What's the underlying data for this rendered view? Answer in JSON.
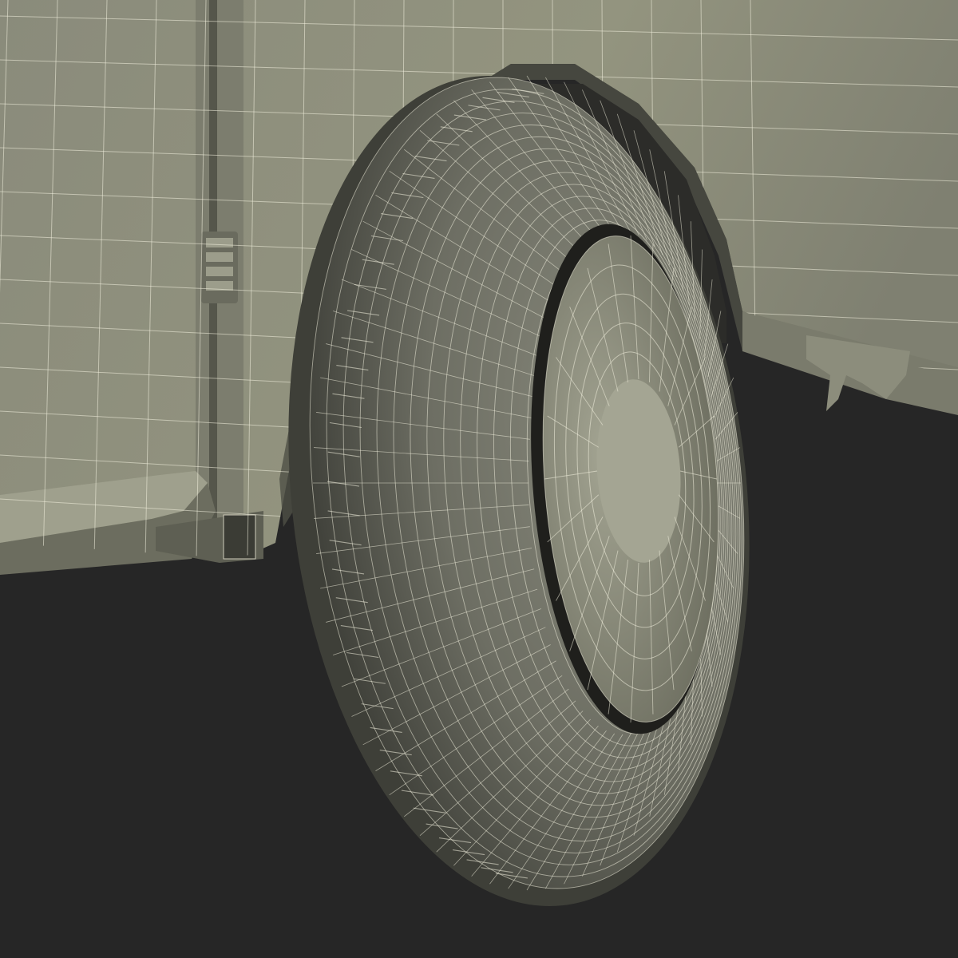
{
  "scene": {
    "colors": {
      "background": "#262626",
      "body_panel": "#8f907f",
      "body_shadow": "#4f5046",
      "wheel_well": "#2c2c29",
      "tire": "#6d6e63",
      "tire_shadow": "#3e3f38",
      "rim": "#8b8c7b",
      "hub": "#9d9e8c",
      "wire": "#f3f1df"
    },
    "wire_opacity": 0.55,
    "tire_meridian_count": 72,
    "tire_parallel_count": 14,
    "rim_spoke_count": 24,
    "rim_ring_count": 5
  }
}
